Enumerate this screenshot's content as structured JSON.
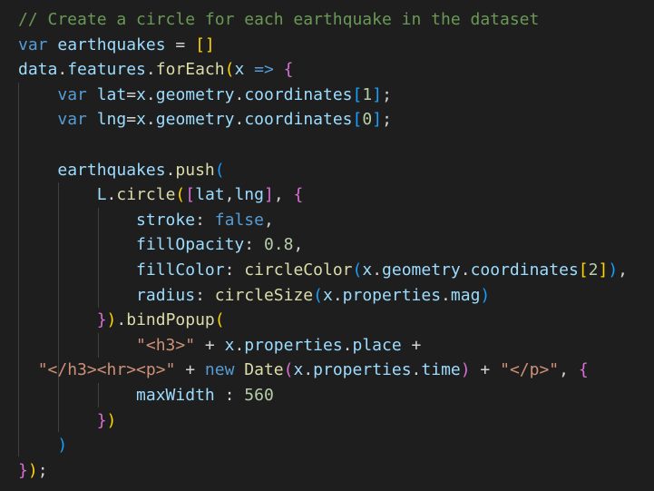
{
  "editor": {
    "theme_colors": {
      "background": "#1e1e1e",
      "comment": "#6a9955",
      "keyword": "#569cd6",
      "variable": "#9cdcfe",
      "function": "#dcdcaa",
      "string": "#ce9178",
      "number": "#b5cea8",
      "punctuation": "#d4d4d4",
      "bracket_1": "#ffd700",
      "bracket_2": "#da70d6",
      "bracket_3": "#179fff",
      "indent_guide": "#404040"
    },
    "lines": [
      [
        {
          "text": "// Create a circle for each earthquake in the dataset",
          "type": "comment"
        }
      ],
      [
        {
          "text": "var",
          "type": "keyword"
        },
        {
          "text": " ",
          "type": "plain"
        },
        {
          "text": "earthquakes",
          "type": "variable"
        },
        {
          "text": " = ",
          "type": "operator"
        },
        {
          "text": "[]",
          "type": "bracket-1"
        }
      ],
      [
        {
          "text": "data",
          "type": "variable"
        },
        {
          "text": ".",
          "type": "punct"
        },
        {
          "text": "features",
          "type": "variable"
        },
        {
          "text": ".",
          "type": "punct"
        },
        {
          "text": "forEach",
          "type": "function"
        },
        {
          "text": "(",
          "type": "bracket-1"
        },
        {
          "text": "x",
          "type": "variable"
        },
        {
          "text": " ",
          "type": "plain"
        },
        {
          "text": "=>",
          "type": "keyword"
        },
        {
          "text": " ",
          "type": "plain"
        },
        {
          "text": "{",
          "type": "bracket-2"
        }
      ],
      [
        {
          "text": "    ",
          "type": "plain"
        },
        {
          "text": "var",
          "type": "keyword"
        },
        {
          "text": " ",
          "type": "plain"
        },
        {
          "text": "lat",
          "type": "variable"
        },
        {
          "text": "=",
          "type": "operator"
        },
        {
          "text": "x",
          "type": "variable"
        },
        {
          "text": ".",
          "type": "punct"
        },
        {
          "text": "geometry",
          "type": "variable"
        },
        {
          "text": ".",
          "type": "punct"
        },
        {
          "text": "coordinates",
          "type": "variable"
        },
        {
          "text": "[",
          "type": "bracket-3"
        },
        {
          "text": "1",
          "type": "number"
        },
        {
          "text": "]",
          "type": "bracket-3"
        },
        {
          "text": ";",
          "type": "punct"
        }
      ],
      [
        {
          "text": "    ",
          "type": "plain"
        },
        {
          "text": "var",
          "type": "keyword"
        },
        {
          "text": " ",
          "type": "plain"
        },
        {
          "text": "lng",
          "type": "variable"
        },
        {
          "text": "=",
          "type": "operator"
        },
        {
          "text": "x",
          "type": "variable"
        },
        {
          "text": ".",
          "type": "punct"
        },
        {
          "text": "geometry",
          "type": "variable"
        },
        {
          "text": ".",
          "type": "punct"
        },
        {
          "text": "coordinates",
          "type": "variable"
        },
        {
          "text": "[",
          "type": "bracket-3"
        },
        {
          "text": "0",
          "type": "number"
        },
        {
          "text": "]",
          "type": "bracket-3"
        },
        {
          "text": ";",
          "type": "punct"
        }
      ],
      [],
      [
        {
          "text": "    ",
          "type": "plain"
        },
        {
          "text": "earthquakes",
          "type": "variable"
        },
        {
          "text": ".",
          "type": "punct"
        },
        {
          "text": "push",
          "type": "function"
        },
        {
          "text": "(",
          "type": "bracket-3"
        }
      ],
      [
        {
          "text": "        ",
          "type": "plain"
        },
        {
          "text": "L",
          "type": "variable"
        },
        {
          "text": ".",
          "type": "punct"
        },
        {
          "text": "circle",
          "type": "function"
        },
        {
          "text": "(",
          "type": "bracket-1"
        },
        {
          "text": "[",
          "type": "bracket-2"
        },
        {
          "text": "lat",
          "type": "variable"
        },
        {
          "text": ",",
          "type": "punct"
        },
        {
          "text": "lng",
          "type": "variable"
        },
        {
          "text": "]",
          "type": "bracket-2"
        },
        {
          "text": ", ",
          "type": "punct"
        },
        {
          "text": "{",
          "type": "bracket-2"
        }
      ],
      [
        {
          "text": "            ",
          "type": "plain"
        },
        {
          "text": "stroke",
          "type": "variable"
        },
        {
          "text": ": ",
          "type": "punct"
        },
        {
          "text": "false",
          "type": "keyword"
        },
        {
          "text": ",",
          "type": "punct"
        }
      ],
      [
        {
          "text": "            ",
          "type": "plain"
        },
        {
          "text": "fillOpacity",
          "type": "variable"
        },
        {
          "text": ": ",
          "type": "punct"
        },
        {
          "text": "0.8",
          "type": "number"
        },
        {
          "text": ",",
          "type": "punct"
        }
      ],
      [
        {
          "text": "            ",
          "type": "plain"
        },
        {
          "text": "fillColor",
          "type": "variable"
        },
        {
          "text": ": ",
          "type": "punct"
        },
        {
          "text": "circleColor",
          "type": "function"
        },
        {
          "text": "(",
          "type": "bracket-3"
        },
        {
          "text": "x",
          "type": "variable"
        },
        {
          "text": ".",
          "type": "punct"
        },
        {
          "text": "geometry",
          "type": "variable"
        },
        {
          "text": ".",
          "type": "punct"
        },
        {
          "text": "coordinates",
          "type": "variable"
        },
        {
          "text": "[",
          "type": "bracket-1"
        },
        {
          "text": "2",
          "type": "number"
        },
        {
          "text": "]",
          "type": "bracket-1"
        },
        {
          "text": ")",
          "type": "bracket-3"
        },
        {
          "text": ",",
          "type": "punct"
        }
      ],
      [
        {
          "text": "            ",
          "type": "plain"
        },
        {
          "text": "radius",
          "type": "variable"
        },
        {
          "text": ": ",
          "type": "punct"
        },
        {
          "text": "circleSize",
          "type": "function"
        },
        {
          "text": "(",
          "type": "bracket-3"
        },
        {
          "text": "x",
          "type": "variable"
        },
        {
          "text": ".",
          "type": "punct"
        },
        {
          "text": "properties",
          "type": "variable"
        },
        {
          "text": ".",
          "type": "punct"
        },
        {
          "text": "mag",
          "type": "variable"
        },
        {
          "text": ")",
          "type": "bracket-3"
        }
      ],
      [
        {
          "text": "        ",
          "type": "plain"
        },
        {
          "text": "}",
          "type": "bracket-2"
        },
        {
          "text": ")",
          "type": "bracket-1"
        },
        {
          "text": ".",
          "type": "punct"
        },
        {
          "text": "bindPopup",
          "type": "function"
        },
        {
          "text": "(",
          "type": "bracket-1"
        }
      ],
      [
        {
          "text": "            ",
          "type": "plain"
        },
        {
          "text": "\"<h3>\"",
          "type": "string"
        },
        {
          "text": " + ",
          "type": "operator"
        },
        {
          "text": "x",
          "type": "variable"
        },
        {
          "text": ".",
          "type": "punct"
        },
        {
          "text": "properties",
          "type": "variable"
        },
        {
          "text": ".",
          "type": "punct"
        },
        {
          "text": "place",
          "type": "variable"
        },
        {
          "text": " +",
          "type": "operator"
        }
      ],
      [
        {
          "text": "  ",
          "type": "plain"
        },
        {
          "text": "\"</h3><hr><p>\"",
          "type": "string"
        },
        {
          "text": " + ",
          "type": "operator"
        },
        {
          "text": "new",
          "type": "keyword"
        },
        {
          "text": " ",
          "type": "plain"
        },
        {
          "text": "Date",
          "type": "function"
        },
        {
          "text": "(",
          "type": "bracket-2"
        },
        {
          "text": "x",
          "type": "variable"
        },
        {
          "text": ".",
          "type": "punct"
        },
        {
          "text": "properties",
          "type": "variable"
        },
        {
          "text": ".",
          "type": "punct"
        },
        {
          "text": "time",
          "type": "variable"
        },
        {
          "text": ")",
          "type": "bracket-2"
        },
        {
          "text": " + ",
          "type": "operator"
        },
        {
          "text": "\"</p>\"",
          "type": "string"
        },
        {
          "text": ", ",
          "type": "punct"
        },
        {
          "text": "{",
          "type": "bracket-2"
        }
      ],
      [
        {
          "text": "            ",
          "type": "plain"
        },
        {
          "text": "maxWidth",
          "type": "variable"
        },
        {
          "text": " : ",
          "type": "punct"
        },
        {
          "text": "560",
          "type": "number"
        }
      ],
      [
        {
          "text": "        ",
          "type": "plain"
        },
        {
          "text": "}",
          "type": "bracket-2"
        },
        {
          "text": ")",
          "type": "bracket-1"
        }
      ],
      [
        {
          "text": "    ",
          "type": "plain"
        },
        {
          "text": ")",
          "type": "bracket-3"
        }
      ],
      [
        {
          "text": "}",
          "type": "bracket-2"
        },
        {
          "text": ")",
          "type": "bracket-1"
        },
        {
          "text": ";",
          "type": "punct"
        }
      ]
    ]
  }
}
